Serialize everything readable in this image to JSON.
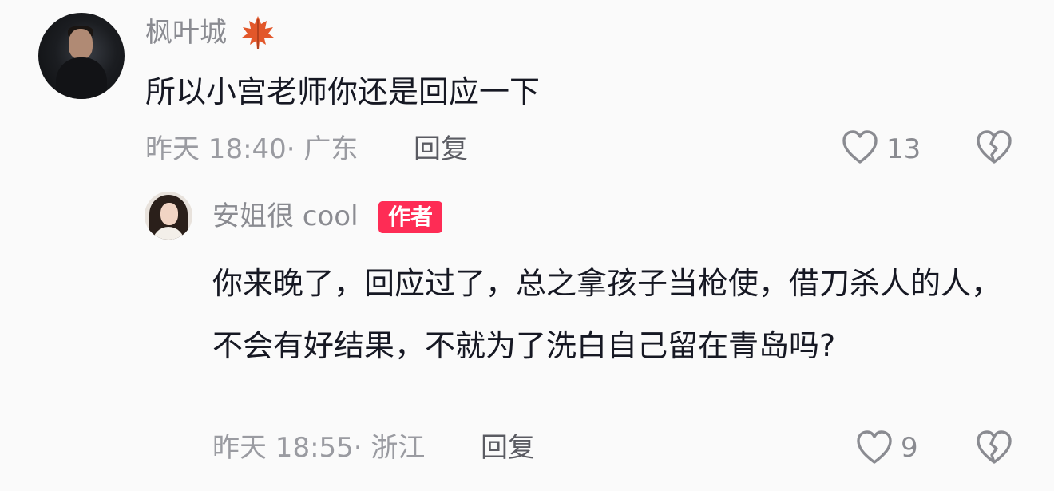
{
  "comment": {
    "username": "枫叶城",
    "emoji_icon": "maple-leaf-icon",
    "text": "所以小宫老师你还是回应一下",
    "meta": "昨天 18:40· 广东",
    "reply_label": "回复",
    "likes": "13",
    "like_icon": "heart-outline-icon",
    "dislike_icon": "broken-heart-icon"
  },
  "reply": {
    "username": "安姐很 cool",
    "badge": "作者",
    "text": "你来晚了，回应过了，总之拿孩子当枪使，借刀杀人的人，不会有好结果，不就为了洗白自己留在青岛吗?",
    "meta": "昨天 18:55· 浙江",
    "reply_label": "回复",
    "likes": "9",
    "like_icon": "heart-outline-icon",
    "dislike_icon": "broken-heart-icon"
  },
  "colors": {
    "background": "#fafafa",
    "badge": "#fe2c55",
    "text": "#161823",
    "secondary": "#9a9ba1"
  }
}
